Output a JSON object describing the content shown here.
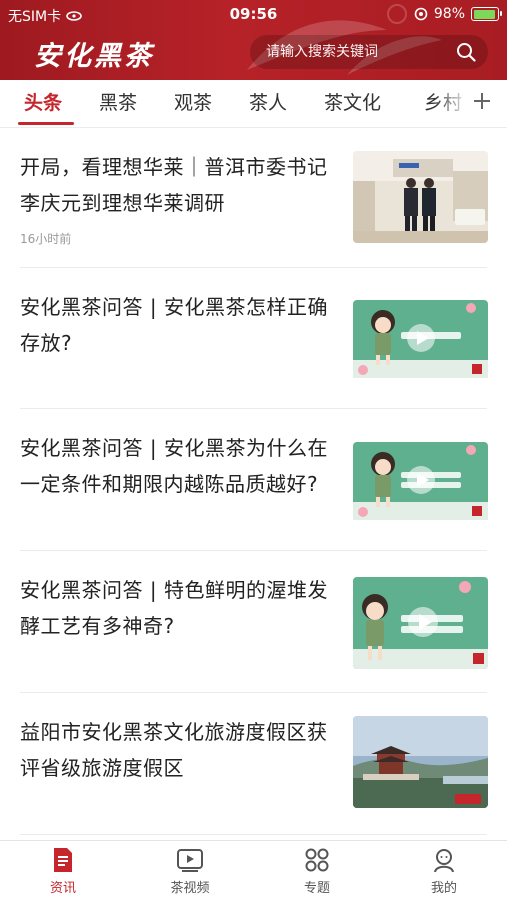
{
  "status_bar": {
    "carrier": "无SIM卡",
    "time": "09:56",
    "battery": "98%",
    "battery_level": 0.98
  },
  "header": {
    "brand": "安化黑茶",
    "search_placeholder": "请输入搜索关键词"
  },
  "tabs": [
    {
      "label": "头条",
      "active": true
    },
    {
      "label": "黑茶"
    },
    {
      "label": "观茶"
    },
    {
      "label": "茶人"
    },
    {
      "label": "茶文化"
    },
    {
      "label": "乡村"
    }
  ],
  "feed": [
    {
      "title": "开局，看理想华莱｜普洱市委书记李庆元到理想华莱调研",
      "time": "16小时前",
      "thumb": "meeting-photo"
    },
    {
      "title": "安化黑茶问答 | 安化黑茶怎样正确存放?",
      "time": "",
      "thumb": "video-cartoon-girl"
    },
    {
      "title": "安化黑茶问答 | 安化黑茶为什么在一定条件和期限内越陈品质越好?",
      "time": "",
      "thumb": "video-cartoon-girl"
    },
    {
      "title": "安化黑茶问答 | 特色鲜明的渥堆发酵工艺有多神奇?",
      "time": "",
      "thumb": "video-cartoon-girl"
    },
    {
      "title": "益阳市安化黑茶文化旅游度假区获评省级旅游度假区",
      "time": "",
      "thumb": "landscape-photo"
    }
  ],
  "bottom_nav": [
    {
      "label": "资讯",
      "icon": "news-icon",
      "active": true
    },
    {
      "label": "茶视频",
      "icon": "video-icon"
    },
    {
      "label": "专题",
      "icon": "topics-grid-icon"
    },
    {
      "label": "我的",
      "icon": "profile-icon"
    }
  ],
  "colors": {
    "brand_red": "#b62228",
    "accent": "#c4262c",
    "video_teal": "#5fb08f"
  }
}
